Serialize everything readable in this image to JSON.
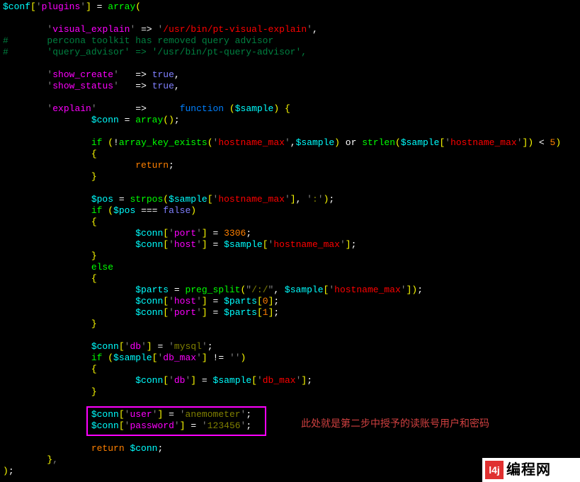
{
  "annotation": "此处就是第二步中授予的读账号用户和密码",
  "logo_mark": "l4j",
  "logo_text": "编程网",
  "code_tokens": [
    [
      [
        "$conf",
        "c-var"
      ],
      [
        "[",
        "c-op"
      ],
      [
        "'",
        "c-pun"
      ],
      [
        "plugins",
        "c-key"
      ],
      [
        "'",
        "c-pun"
      ],
      [
        "]",
        "c-op"
      ],
      [
        " = ",
        "c-white"
      ],
      [
        "array",
        "c-func"
      ],
      [
        "(",
        "c-op"
      ]
    ],
    [],
    [
      [
        "        ",
        "c-white"
      ],
      [
        "'",
        "c-pun"
      ],
      [
        "visual_explain",
        "c-key"
      ],
      [
        "'",
        "c-pun"
      ],
      [
        " => ",
        "c-white"
      ],
      [
        "'",
        "c-pun"
      ],
      [
        "/usr/bin/pt-visual-explain",
        "c-str"
      ],
      [
        "'",
        "c-pun"
      ],
      [
        ",",
        "c-white"
      ]
    ],
    [
      [
        "#       percona toolkit has removed query advisor",
        "c-comm"
      ]
    ],
    [
      [
        "#       'query_advisor' => '/usr/bin/pt-query-advisor',",
        "c-comm"
      ]
    ],
    [],
    [
      [
        "        ",
        "c-white"
      ],
      [
        "'",
        "c-pun"
      ],
      [
        "show_create",
        "c-key"
      ],
      [
        "'",
        "c-pun"
      ],
      [
        "   => ",
        "c-white"
      ],
      [
        "true",
        "c-bool"
      ],
      [
        ",",
        "c-white"
      ]
    ],
    [
      [
        "        ",
        "c-white"
      ],
      [
        "'",
        "c-pun"
      ],
      [
        "show_status",
        "c-key"
      ],
      [
        "'",
        "c-pun"
      ],
      [
        "   => ",
        "c-white"
      ],
      [
        "true",
        "c-bool"
      ],
      [
        ",",
        "c-white"
      ]
    ],
    [],
    [
      [
        "        ",
        "c-white"
      ],
      [
        "'",
        "c-pun"
      ],
      [
        "explain",
        "c-key"
      ],
      [
        "'",
        "c-pun"
      ],
      [
        "       =>      ",
        "c-white"
      ],
      [
        "function ",
        "c-type"
      ],
      [
        "(",
        "c-op"
      ],
      [
        "$sample",
        "c-var"
      ],
      [
        ")",
        "c-op"
      ],
      [
        " ",
        "c-white"
      ],
      [
        "{",
        "c-op"
      ]
    ],
    [
      [
        "                ",
        "c-white"
      ],
      [
        "$conn",
        "c-var"
      ],
      [
        " = ",
        "c-white"
      ],
      [
        "array",
        "c-func"
      ],
      [
        "()",
        "c-op"
      ],
      [
        ";",
        "c-white"
      ]
    ],
    [],
    [
      [
        "                ",
        "c-white"
      ],
      [
        "if ",
        "c-func"
      ],
      [
        "(",
        "c-op"
      ],
      [
        "!",
        "c-white"
      ],
      [
        "array_key_exists",
        "c-func"
      ],
      [
        "(",
        "c-op"
      ],
      [
        "'",
        "c-pun"
      ],
      [
        "hostname_max",
        "c-str"
      ],
      [
        "'",
        "c-pun"
      ],
      [
        ",",
        "c-white"
      ],
      [
        "$sample",
        "c-var"
      ],
      [
        ")",
        "c-op"
      ],
      [
        " or ",
        "c-white"
      ],
      [
        "strlen",
        "c-func"
      ],
      [
        "(",
        "c-op"
      ],
      [
        "$sample",
        "c-var"
      ],
      [
        "[",
        "c-op"
      ],
      [
        "'",
        "c-pun"
      ],
      [
        "hostname_max",
        "c-str"
      ],
      [
        "'",
        "c-pun"
      ],
      [
        "]",
        "c-op"
      ],
      [
        ")",
        "c-op"
      ],
      [
        " < ",
        "c-white"
      ],
      [
        "5",
        "c-num"
      ],
      [
        ")",
        "c-op"
      ]
    ],
    [
      [
        "                ",
        "c-white"
      ],
      [
        "{",
        "c-op"
      ]
    ],
    [
      [
        "                        ",
        "c-white"
      ],
      [
        "return",
        "c-orange"
      ],
      [
        ";",
        "c-white"
      ]
    ],
    [
      [
        "                ",
        "c-white"
      ],
      [
        "}",
        "c-op"
      ]
    ],
    [],
    [
      [
        "                ",
        "c-white"
      ],
      [
        "$pos",
        "c-var"
      ],
      [
        " = ",
        "c-white"
      ],
      [
        "strpos",
        "c-func"
      ],
      [
        "(",
        "c-op"
      ],
      [
        "$sample",
        "c-var"
      ],
      [
        "[",
        "c-op"
      ],
      [
        "'",
        "c-pun"
      ],
      [
        "hostname_max",
        "c-str"
      ],
      [
        "'",
        "c-pun"
      ],
      [
        "]",
        "c-op"
      ],
      [
        ", ",
        "c-white"
      ],
      [
        "'",
        "c-pun"
      ],
      [
        ":",
        "c-strp"
      ],
      [
        "'",
        "c-pun"
      ],
      [
        ")",
        "c-op"
      ],
      [
        ";",
        "c-white"
      ]
    ],
    [
      [
        "                ",
        "c-white"
      ],
      [
        "if ",
        "c-func"
      ],
      [
        "(",
        "c-op"
      ],
      [
        "$pos",
        "c-var"
      ],
      [
        " === ",
        "c-white"
      ],
      [
        "false",
        "c-bool"
      ],
      [
        ")",
        "c-op"
      ]
    ],
    [
      [
        "                ",
        "c-white"
      ],
      [
        "{",
        "c-op"
      ]
    ],
    [
      [
        "                        ",
        "c-white"
      ],
      [
        "$conn",
        "c-var"
      ],
      [
        "[",
        "c-op"
      ],
      [
        "'",
        "c-pun"
      ],
      [
        "port",
        "c-key"
      ],
      [
        "'",
        "c-pun"
      ],
      [
        "]",
        "c-op"
      ],
      [
        " = ",
        "c-white"
      ],
      [
        "3306",
        "c-num"
      ],
      [
        ";",
        "c-white"
      ]
    ],
    [
      [
        "                        ",
        "c-white"
      ],
      [
        "$conn",
        "c-var"
      ],
      [
        "[",
        "c-op"
      ],
      [
        "'",
        "c-pun"
      ],
      [
        "host",
        "c-key"
      ],
      [
        "'",
        "c-pun"
      ],
      [
        "]",
        "c-op"
      ],
      [
        " = ",
        "c-white"
      ],
      [
        "$sample",
        "c-var"
      ],
      [
        "[",
        "c-op"
      ],
      [
        "'",
        "c-pun"
      ],
      [
        "hostname_max",
        "c-str"
      ],
      [
        "'",
        "c-pun"
      ],
      [
        "]",
        "c-op"
      ],
      [
        ";",
        "c-white"
      ]
    ],
    [
      [
        "                ",
        "c-white"
      ],
      [
        "}",
        "c-op"
      ]
    ],
    [
      [
        "                ",
        "c-white"
      ],
      [
        "else",
        "c-func"
      ]
    ],
    [
      [
        "                ",
        "c-white"
      ],
      [
        "{",
        "c-op"
      ]
    ],
    [
      [
        "                        ",
        "c-white"
      ],
      [
        "$parts",
        "c-var"
      ],
      [
        " = ",
        "c-white"
      ],
      [
        "preg_split",
        "c-func"
      ],
      [
        "(",
        "c-op"
      ],
      [
        "\"",
        "c-pun"
      ],
      [
        "/:/",
        "c-strp"
      ],
      [
        "\"",
        "c-pun"
      ],
      [
        ", ",
        "c-white"
      ],
      [
        "$sample",
        "c-var"
      ],
      [
        "[",
        "c-op"
      ],
      [
        "'",
        "c-pun"
      ],
      [
        "hostname_max",
        "c-str"
      ],
      [
        "'",
        "c-pun"
      ],
      [
        "]",
        "c-op"
      ],
      [
        ")",
        "c-op"
      ],
      [
        ";",
        "c-white"
      ]
    ],
    [
      [
        "                        ",
        "c-white"
      ],
      [
        "$conn",
        "c-var"
      ],
      [
        "[",
        "c-op"
      ],
      [
        "'",
        "c-pun"
      ],
      [
        "host",
        "c-key"
      ],
      [
        "'",
        "c-pun"
      ],
      [
        "]",
        "c-op"
      ],
      [
        " = ",
        "c-white"
      ],
      [
        "$parts",
        "c-var"
      ],
      [
        "[",
        "c-op"
      ],
      [
        "0",
        "c-num"
      ],
      [
        "]",
        "c-op"
      ],
      [
        ";",
        "c-white"
      ]
    ],
    [
      [
        "                        ",
        "c-white"
      ],
      [
        "$conn",
        "c-var"
      ],
      [
        "[",
        "c-op"
      ],
      [
        "'",
        "c-pun"
      ],
      [
        "port",
        "c-key"
      ],
      [
        "'",
        "c-pun"
      ],
      [
        "]",
        "c-op"
      ],
      [
        " = ",
        "c-white"
      ],
      [
        "$parts",
        "c-var"
      ],
      [
        "[",
        "c-op"
      ],
      [
        "1",
        "c-num"
      ],
      [
        "]",
        "c-op"
      ],
      [
        ";",
        "c-white"
      ]
    ],
    [
      [
        "                ",
        "c-white"
      ],
      [
        "}",
        "c-op"
      ]
    ],
    [],
    [
      [
        "                ",
        "c-white"
      ],
      [
        "$conn",
        "c-var"
      ],
      [
        "[",
        "c-op"
      ],
      [
        "'",
        "c-pun"
      ],
      [
        "db",
        "c-key"
      ],
      [
        "'",
        "c-pun"
      ],
      [
        "]",
        "c-op"
      ],
      [
        " = ",
        "c-white"
      ],
      [
        "'",
        "c-pun"
      ],
      [
        "mysql",
        "c-strp"
      ],
      [
        "'",
        "c-pun"
      ],
      [
        ";",
        "c-white"
      ]
    ],
    [
      [
        "                ",
        "c-white"
      ],
      [
        "if ",
        "c-func"
      ],
      [
        "(",
        "c-op"
      ],
      [
        "$sample",
        "c-var"
      ],
      [
        "[",
        "c-op"
      ],
      [
        "'",
        "c-pun"
      ],
      [
        "db_max",
        "c-key"
      ],
      [
        "'",
        "c-pun"
      ],
      [
        "]",
        "c-op"
      ],
      [
        " != ",
        "c-white"
      ],
      [
        "''",
        "c-pun"
      ],
      [
        ")",
        "c-op"
      ]
    ],
    [
      [
        "                ",
        "c-white"
      ],
      [
        "{",
        "c-op"
      ]
    ],
    [
      [
        "                        ",
        "c-white"
      ],
      [
        "$conn",
        "c-var"
      ],
      [
        "[",
        "c-op"
      ],
      [
        "'",
        "c-pun"
      ],
      [
        "db",
        "c-key"
      ],
      [
        "'",
        "c-pun"
      ],
      [
        "]",
        "c-op"
      ],
      [
        " = ",
        "c-white"
      ],
      [
        "$sample",
        "c-var"
      ],
      [
        "[",
        "c-op"
      ],
      [
        "'",
        "c-pun"
      ],
      [
        "db_max",
        "c-str"
      ],
      [
        "'",
        "c-pun"
      ],
      [
        "]",
        "c-op"
      ],
      [
        ";",
        "c-white"
      ]
    ],
    [
      [
        "                ",
        "c-white"
      ],
      [
        "}",
        "c-op"
      ]
    ],
    [],
    [
      [
        "                ",
        "c-white"
      ],
      [
        "$conn",
        "c-var"
      ],
      [
        "[",
        "c-op"
      ],
      [
        "'",
        "c-pun"
      ],
      [
        "user",
        "c-key"
      ],
      [
        "'",
        "c-pun"
      ],
      [
        "]",
        "c-op"
      ],
      [
        " = ",
        "c-white"
      ],
      [
        "'",
        "c-pun"
      ],
      [
        "anemometer",
        "c-strp"
      ],
      [
        "'",
        "c-pun"
      ],
      [
        ";",
        "c-white"
      ]
    ],
    [
      [
        "                ",
        "c-white"
      ],
      [
        "$conn",
        "c-var"
      ],
      [
        "[",
        "c-op"
      ],
      [
        "'",
        "c-pun"
      ],
      [
        "password",
        "c-key"
      ],
      [
        "'",
        "c-pun"
      ],
      [
        "]",
        "c-op"
      ],
      [
        " = ",
        "c-white"
      ],
      [
        "'",
        "c-pun"
      ],
      [
        "123456",
        "c-strp"
      ],
      [
        "'",
        "c-pun"
      ],
      [
        ";",
        "c-white"
      ]
    ],
    [],
    [
      [
        "                ",
        "c-white"
      ],
      [
        "return ",
        "c-orange"
      ],
      [
        "$conn",
        "c-var"
      ],
      [
        ";",
        "c-white"
      ]
    ],
    [
      [
        "        ",
        "c-white"
      ],
      [
        "}",
        "c-op"
      ],
      [
        ",",
        "c-gray"
      ]
    ],
    [
      [
        ")",
        "c-op"
      ],
      [
        ";",
        "c-white"
      ]
    ]
  ]
}
